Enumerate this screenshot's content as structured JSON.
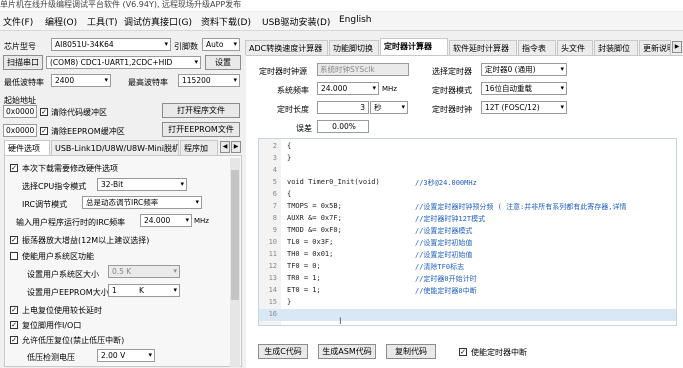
{
  "window": {
    "title": "单片机在线升级编程调试平台软件 (V6.94Y), 远程现场升级APP发布"
  },
  "menu": [
    "文件(F)",
    "编程(O)",
    "工具(T)",
    "调试仿真接口(G)",
    "资料下载(D)",
    "USB驱动安装(D)",
    "English"
  ],
  "left": {
    "chip_label": "芯片型号",
    "chip_value": "AI8051U-34K64",
    "pin_label": "引脚数",
    "pin_value": "Auto",
    "scan_button": "扫描串口",
    "port_value": "(COM8) CDC1-UART1,2CDC+HID",
    "settings_button": "设置",
    "min_baud_label": "最低波特率",
    "min_baud_value": "2400",
    "max_baud_label": "最高波特率",
    "max_baud_value": "115200",
    "start_addr_label": "起始地址",
    "addr1": "0x0000",
    "clear_code": "清除代码缓冲区",
    "open_program": "打开程序文件",
    "addr2": "0x0000",
    "clear_eeprom": "清除EEPROM缓冲区",
    "open_eeprom": "打开EEPROM文件",
    "tabs": [
      "硬件选项",
      "USB-Link1D/U8W/U8W-Mini脱机",
      "程序加"
    ],
    "opts": {
      "reload_label": "本次下载需要修改硬件选项",
      "cpu_label": "选择CPU指令模式",
      "cpu_value": "32-Bit",
      "irc_label": "IRC调节模式",
      "irc_value": "总是动态调节IRC频率",
      "freq_label": "输入用户程序运行时的IRC频率",
      "freq_value": "24.000",
      "freq_unit": "MHz",
      "amp_label": "振荡器放大增益(12M以上建议选择)",
      "sys_area_label": "使能用户系统区功能",
      "sys_size_label": "设置用户系统区大小",
      "sys_size_value": "0.5 K",
      "eeprom_size_label": "设置用户EEPROM大小",
      "eeprom_size_value": "1",
      "eeprom_size_unit": "K",
      "por_label": "上电复位使用较长延时",
      "reset_io_label": "复位脚用作I/O口",
      "lvr_label": "允许低压复位(禁止低压中断)",
      "lvd_label": "低压检测电压",
      "lvd_value": "2.00 V"
    }
  },
  "right": {
    "tabs": [
      "ADC转换速度计算器",
      "功能脚切换",
      "定时器计算器",
      "软件延时计算器",
      "指令表",
      "头文件",
      "封装脚位",
      "更新说明"
    ],
    "active_tab": "定时器计算器",
    "clock_src_label": "定时器时钟源",
    "clock_src_value": "系统时钟SYSclk",
    "select_timer_label": "选择定时器",
    "select_timer_value": "定时器0 (通用)",
    "sys_freq_label": "系统频率",
    "sys_freq_value": "24.000",
    "sys_freq_unit": "MHz",
    "timer_mode_label": "定时器模式",
    "timer_mode_value": "16位自动重载",
    "timer_len_label": "定时长度",
    "timer_len_value": "3",
    "timer_len_unit": "秒",
    "timer_clk_label": "定时器时钟",
    "timer_clk_value": "12T (FOSC/12)",
    "error_label": "误差",
    "error_value": "0.00%",
    "code_lines": [
      {
        "n": "2",
        "code": "{",
        "cmt": ""
      },
      {
        "n": "3",
        "code": "}",
        "cmt": ""
      },
      {
        "n": "4",
        "code": "",
        "cmt": ""
      },
      {
        "n": "5",
        "code": "void Timer0_Init(void)",
        "cmt": "//3秒@24.000MHz"
      },
      {
        "n": "6",
        "code": "{",
        "cmt": ""
      },
      {
        "n": "7",
        "code": "    TMOPS = 0x5B;",
        "cmt": "//设置定时器时钟预分频 ( 注意:并非所有系列都有此寄存器,详情"
      },
      {
        "n": "8",
        "code": "    AUXR &= 0x7F;",
        "cmt": "//定时器时钟12T模式"
      },
      {
        "n": "9",
        "code": "    TMOD &= 0xF0;",
        "cmt": "//设置定时器模式"
      },
      {
        "n": "10",
        "code": "    TL0 = 0x3F;",
        "cmt": "//设置定时初始值"
      },
      {
        "n": "11",
        "code": "    TH0 = 0x01;",
        "cmt": "//设置定时初始值"
      },
      {
        "n": "12",
        "code": "    TF0 = 0;",
        "cmt": "//清除TF0标志"
      },
      {
        "n": "13",
        "code": "    TR0 = 1;",
        "cmt": "//定时器0开始计时"
      },
      {
        "n": "14",
        "code": "    ET0 = 1;",
        "cmt": "//使能定时器0中断"
      },
      {
        "n": "15",
        "code": "}",
        "cmt": ""
      },
      {
        "n": "16",
        "code": "",
        "cmt": ""
      }
    ],
    "gen_c": "生成C代码",
    "gen_asm": "生成ASM代码",
    "copy_code": "复制代码",
    "enable_int_label": "使能定时器中断"
  }
}
